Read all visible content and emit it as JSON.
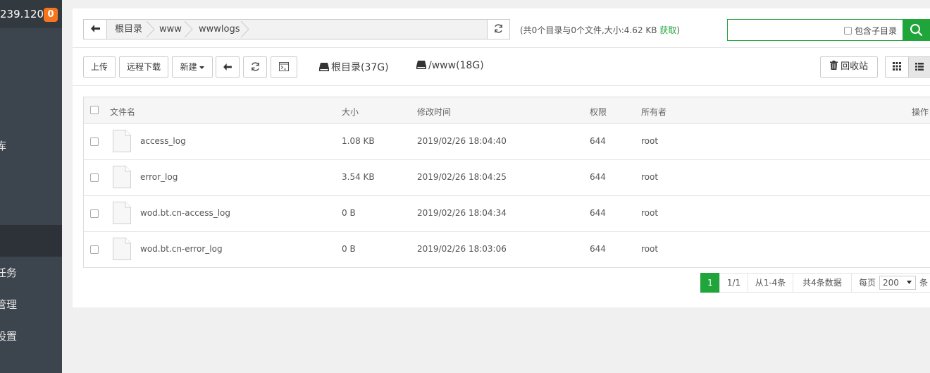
{
  "sidebar": {
    "ip": "239.120",
    "badge": "0",
    "items": [
      {
        "label": "库"
      },
      {
        "label": "任务"
      },
      {
        "label": "管理"
      },
      {
        "label": "设置"
      }
    ]
  },
  "pathbar": {
    "crumbs": [
      "根目录",
      "www",
      "wwwlogs"
    ]
  },
  "summary": {
    "text": "(共0个目录与0个文件,大小:4.62 KB ",
    "fetch": "获取",
    "close": ")"
  },
  "search": {
    "value": "",
    "include_sub": "包含子目录"
  },
  "toolbar": {
    "upload": "上传",
    "remote_download": "远程下载",
    "new": "新建",
    "disks": [
      "根目录(37G)",
      "/www(18G)"
    ],
    "recycle": "回收站"
  },
  "table": {
    "headers": {
      "name": "文件名",
      "size": "大小",
      "mtime": "修改时间",
      "perm": "权限",
      "owner": "所有者",
      "ops": "操作"
    },
    "rows": [
      {
        "name": "access_log",
        "size": "1.08 KB",
        "mtime": "2019/02/26 18:04:40",
        "perm": "644",
        "owner": "root"
      },
      {
        "name": "error_log",
        "size": "3.54 KB",
        "mtime": "2019/02/26 18:04:25",
        "perm": "644",
        "owner": "root"
      },
      {
        "name": "wod.bt.cn-access_log",
        "size": "0 B",
        "mtime": "2019/02/26 18:04:34",
        "perm": "644",
        "owner": "root"
      },
      {
        "name": "wod.bt.cn-error_log",
        "size": "0 B",
        "mtime": "2019/02/26 18:03:06",
        "perm": "644",
        "owner": "root"
      }
    ]
  },
  "pager": {
    "current": "1",
    "pages": "1/1",
    "range": "从1-4条",
    "total": "共4条数据",
    "per_page_label": "每页",
    "per_page": "200",
    "unit": "条"
  },
  "colors": {
    "accent": "#20a53a",
    "sidebar": "#3c444d",
    "badge": "#f7751c"
  }
}
